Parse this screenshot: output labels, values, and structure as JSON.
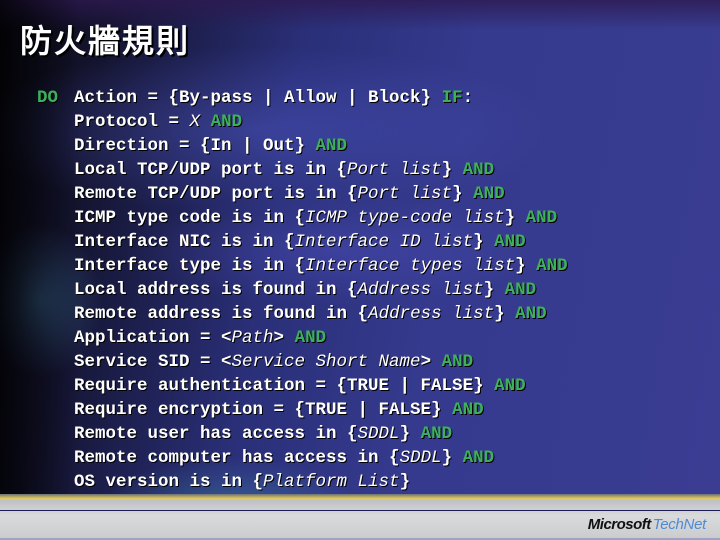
{
  "slide": {
    "title": "防火牆規則",
    "keyword_color": "#3fb05a",
    "lines": [
      {
        "prefix": "DO",
        "segments": [
          {
            "t": "Action = {By-pass | Allow | Block} "
          },
          {
            "t": "IF",
            "kw": true
          },
          {
            "t": ":"
          }
        ]
      },
      {
        "segments": [
          {
            "t": "Protocol = "
          },
          {
            "t": "X",
            "it": true
          },
          {
            "t": " "
          },
          {
            "t": "AND",
            "kw": true
          }
        ]
      },
      {
        "segments": [
          {
            "t": "Direction = {In | Out} "
          },
          {
            "t": "AND",
            "kw": true
          }
        ]
      },
      {
        "segments": [
          {
            "t": "Local TCP/UDP port is in {"
          },
          {
            "t": "Port list",
            "it": true
          },
          {
            "t": "} "
          },
          {
            "t": "AND",
            "kw": true
          }
        ]
      },
      {
        "segments": [
          {
            "t": "Remote TCP/UDP port is in {"
          },
          {
            "t": "Port list",
            "it": true
          },
          {
            "t": "} "
          },
          {
            "t": "AND",
            "kw": true
          }
        ]
      },
      {
        "segments": [
          {
            "t": "ICMP type code is in {"
          },
          {
            "t": "ICMP type-code list",
            "it": true
          },
          {
            "t": "} "
          },
          {
            "t": "AND",
            "kw": true
          }
        ]
      },
      {
        "segments": [
          {
            "t": "Interface NIC is in {"
          },
          {
            "t": "Interface ID list",
            "it": true
          },
          {
            "t": "} "
          },
          {
            "t": "AND",
            "kw": true
          }
        ]
      },
      {
        "segments": [
          {
            "t": "Interface type is in {"
          },
          {
            "t": "Interface types list",
            "it": true
          },
          {
            "t": "} "
          },
          {
            "t": "AND",
            "kw": true
          }
        ]
      },
      {
        "segments": [
          {
            "t": "Local address is found in {"
          },
          {
            "t": "Address list",
            "it": true
          },
          {
            "t": "} "
          },
          {
            "t": "AND",
            "kw": true
          }
        ]
      },
      {
        "segments": [
          {
            "t": "Remote address is found in {"
          },
          {
            "t": "Address list",
            "it": true
          },
          {
            "t": "} "
          },
          {
            "t": "AND",
            "kw": true
          }
        ]
      },
      {
        "segments": [
          {
            "t": "Application = <"
          },
          {
            "t": "Path",
            "it": true
          },
          {
            "t": "> "
          },
          {
            "t": "AND",
            "kw": true
          }
        ]
      },
      {
        "segments": [
          {
            "t": "Service SID = <"
          },
          {
            "t": "Service Short Name",
            "it": true
          },
          {
            "t": "> "
          },
          {
            "t": "AND",
            "kw": true
          }
        ]
      },
      {
        "segments": [
          {
            "t": "Require authentication = {TRUE | FALSE} "
          },
          {
            "t": "AND",
            "kw": true
          }
        ]
      },
      {
        "segments": [
          {
            "t": "Require encryption = {TRUE | FALSE} "
          },
          {
            "t": "AND",
            "kw": true
          }
        ]
      },
      {
        "segments": [
          {
            "t": "Remote user has access in {"
          },
          {
            "t": "SDDL",
            "it": true
          },
          {
            "t": "} "
          },
          {
            "t": "AND",
            "kw": true
          }
        ]
      },
      {
        "segments": [
          {
            "t": "Remote computer has access in {"
          },
          {
            "t": "SDDL",
            "it": true
          },
          {
            "t": "} "
          },
          {
            "t": "AND",
            "kw": true
          }
        ]
      },
      {
        "segments": [
          {
            "t": "OS version is in {"
          },
          {
            "t": "Platform List",
            "it": true
          },
          {
            "t": "}"
          }
        ]
      }
    ]
  },
  "footer": {
    "logo_brand": "Microsoft",
    "logo_product": "TechNet"
  }
}
